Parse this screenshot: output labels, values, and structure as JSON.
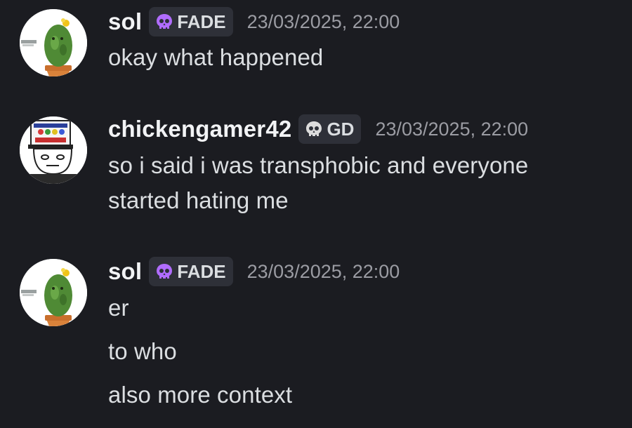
{
  "messages": [
    {
      "username": "sol",
      "tag": "FADE",
      "tag_icon": "skull-icon",
      "tag_icon_color": "#b06cff",
      "timestamp": "23/03/2025, 22:00",
      "lines": [
        "okay what happened"
      ]
    },
    {
      "username": "chickengamer42",
      "tag": "GD",
      "tag_icon": "skull-icon",
      "tag_icon_color": "#dcdcdc",
      "timestamp": "23/03/2025, 22:00",
      "lines": [
        "so i said i was transphobic and everyone",
        "started hating me"
      ]
    },
    {
      "username": "sol",
      "tag": "FADE",
      "tag_icon": "skull-icon",
      "tag_icon_color": "#b06cff",
      "timestamp": "23/03/2025, 22:00",
      "lines": [
        "er",
        "to who",
        "also more context"
      ]
    }
  ],
  "colors": {
    "background": "#1b1c21",
    "username": "#f2f3f5",
    "message_text": "#dbdee1",
    "timestamp": "#9b9ca3",
    "tag_background": "#2e3038"
  }
}
